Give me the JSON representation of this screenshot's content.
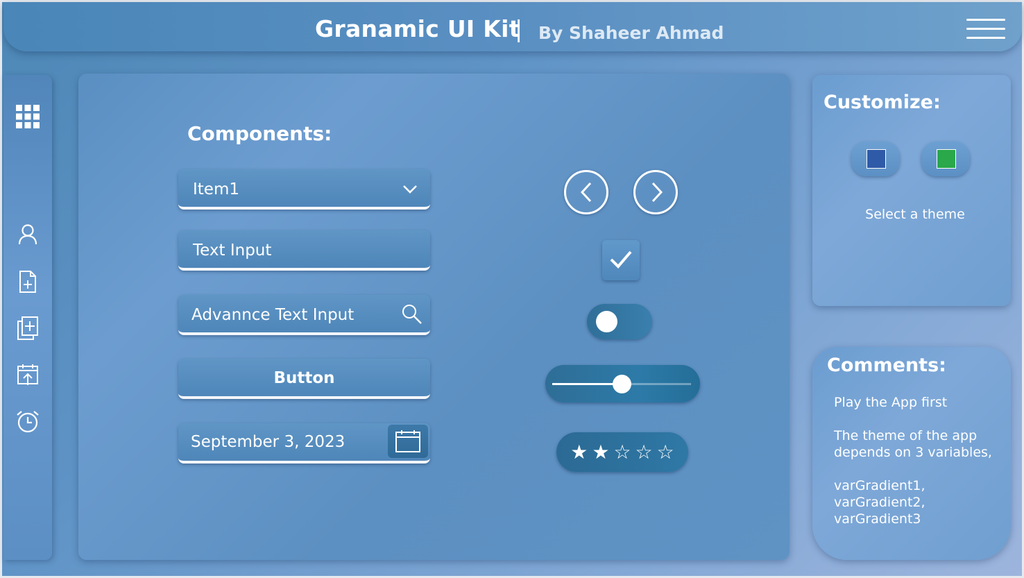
{
  "header": {
    "title": "Granamic UI Kit",
    "separator": "|",
    "subtitle": "By Shaheer Ahmad"
  },
  "sidebar": {
    "icons": [
      "apps-grid-icon",
      "user-icon",
      "add-document-icon",
      "add-pages-icon",
      "calendar-upload-icon",
      "alarm-clock-icon"
    ]
  },
  "main": {
    "title": "Components:",
    "dropdown": {
      "value": "Item1"
    },
    "text_input": {
      "value": "Text Input"
    },
    "advanced_input": {
      "value": "Advannce Text Input"
    },
    "button": {
      "label": "Button"
    },
    "date_picker": {
      "value": "September 3, 2023"
    },
    "checkbox": {
      "checked": true
    },
    "toggle": {
      "on": false
    },
    "slider": {
      "value": 0.5
    },
    "rating": {
      "value": 2,
      "max": 5
    }
  },
  "customize": {
    "title": "Customize:",
    "themes": [
      {
        "name": "blue",
        "color": "#2f5aa8"
      },
      {
        "name": "green",
        "color": "#2aa84a"
      }
    ],
    "label": "Select a theme"
  },
  "comments": {
    "title": "Comments:",
    "line1": "Play the App first",
    "line2": "The theme of the app",
    "line3": "depends on 3 variables,",
    "line4": "varGradient1,",
    "line5": "varGradient2,",
    "line6": "varGradient3"
  }
}
